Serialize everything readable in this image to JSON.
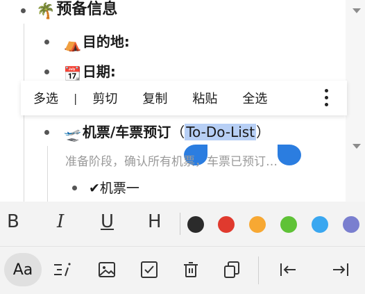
{
  "doc": {
    "heading": {
      "emoji": "🌴",
      "text": "预备信息"
    },
    "items": [
      {
        "emoji": "⛺",
        "text": "目的地:"
      },
      {
        "emoji": "📆",
        "text": "日期:"
      }
    ],
    "ticket": {
      "emoji": "🛫",
      "text": "机票/车票预订",
      "open_paren": "（",
      "selected": "To-Do-List",
      "close_paren": "）"
    },
    "note": "准备阶段，确认所有机票，车票已预订…",
    "subitem": {
      "check": "✔",
      "text": "机票一"
    }
  },
  "context_menu": {
    "items": [
      "多选",
      "剪切",
      "复制",
      "粘贴",
      "全选"
    ],
    "separator": "|"
  },
  "format_bar": {
    "bold": "B",
    "italic": "I",
    "underline": "U",
    "heading": "H",
    "colors": [
      "#2b2b2b",
      "#e03a2e",
      "#f7a833",
      "#5fc237",
      "#3aa7f0",
      "#7a7fcf"
    ]
  },
  "toolbar": {
    "text_style": "Aa"
  }
}
